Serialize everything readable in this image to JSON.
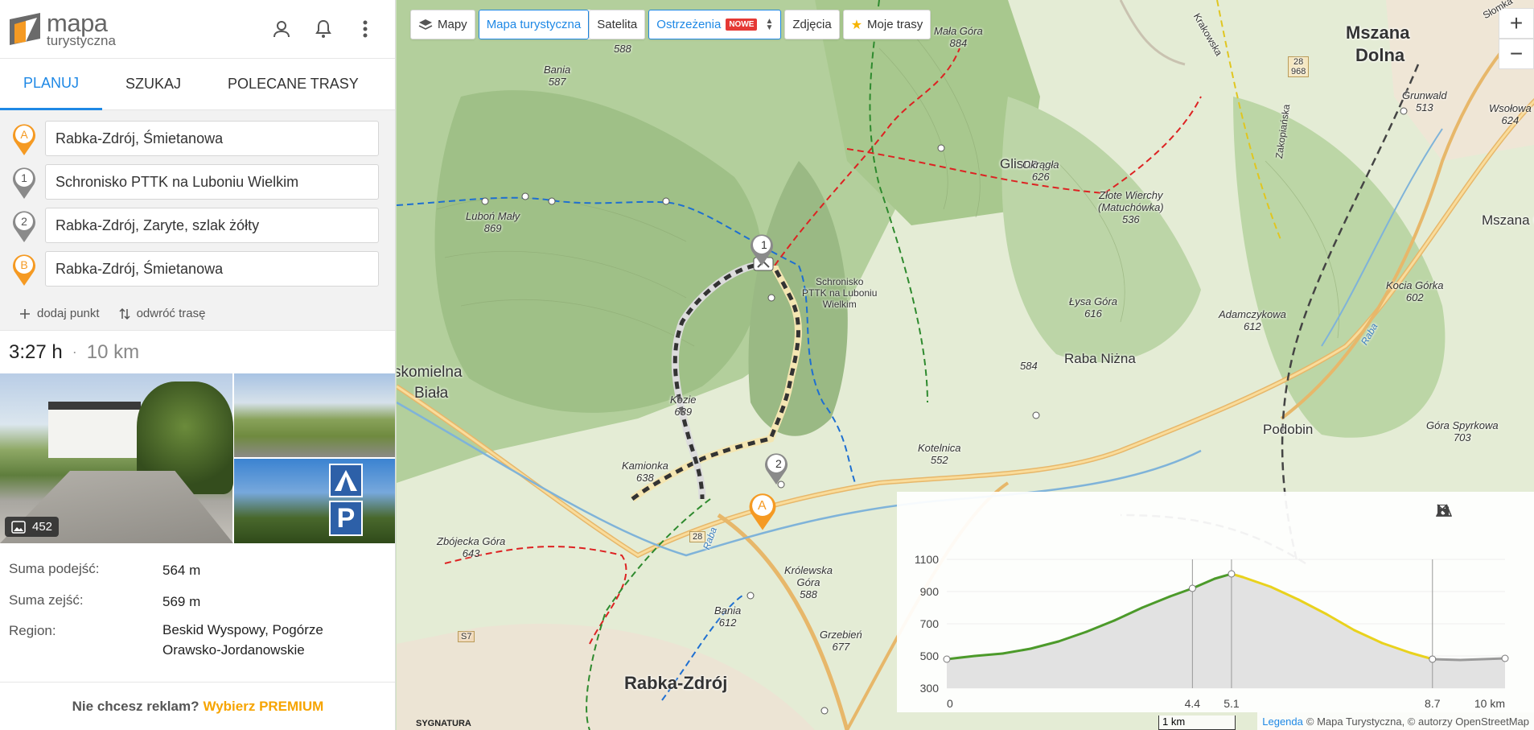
{
  "app": {
    "logo_line1": "mapa",
    "logo_line2": "turystyczna"
  },
  "tabs": [
    {
      "label": "PLANUJ",
      "active": true
    },
    {
      "label": "SZUKAJ",
      "active": false
    },
    {
      "label": "POLECANE TRASY",
      "active": false
    }
  ],
  "route": {
    "points": [
      {
        "marker": "A",
        "value": "Rabka-Zdrój, Śmietanowa",
        "color": "#f59a23"
      },
      {
        "marker": "1",
        "value": "Schronisko PTTK na Luboniu Wielkim",
        "color": "#8a8a8a"
      },
      {
        "marker": "2",
        "value": "Rabka-Zdrój, Zaryte, szlak żółty",
        "color": "#8a8a8a"
      },
      {
        "marker": "B",
        "value": "Rabka-Zdrój, Śmietanowa",
        "color": "#f59a23"
      }
    ],
    "add_point_label": "dodaj punkt",
    "reverse_label": "odwróć trasę"
  },
  "summary": {
    "time": "3:27 h",
    "separator": "·",
    "distance": "10 km"
  },
  "photos": {
    "count": "452"
  },
  "stats": {
    "ascent_label": "Suma podejść:",
    "ascent_value": "564 m",
    "descent_label": "Suma zejść:",
    "descent_value": "569 m",
    "region_label": "Region:",
    "region_value_line1": "Beskid Wyspowy, Pogórze",
    "region_value_line2": "Orawsko-Jordanowskie"
  },
  "ad": {
    "text": "Nie chcesz reklam?",
    "premium": "Wybierz PREMIUM"
  },
  "map_controls": {
    "maps": "Mapy",
    "tourist": "Mapa turystyczna",
    "satellite": "Satelita",
    "warnings": "Ostrzeżenia",
    "new_badge": "NOWE",
    "photos": "Zdjęcia",
    "my_routes": "Moje trasy",
    "zoom_in": "+",
    "zoom_out": "−"
  },
  "map_labels": {
    "mszana": "Mszana",
    "dolna": "Dolna",
    "glisne": "Glisne",
    "raba_nizna": "Raba Niżna",
    "podobin": "Podobin",
    "skomielna": "skomielna",
    "biala": "Biała",
    "rabka": "Rabka-Zdrój",
    "mszana_gorna": "Mszana Górn",
    "mala_gora": "Mała Góra",
    "mala_gora_h": "884",
    "bania1": "Bania",
    "bania1_h": "587",
    "h588top": "588",
    "lubon_maly": "Luboń Mały",
    "lubon_maly_h": "869",
    "okragla": "Okrągła",
    "okragla_h": "626",
    "zlote_wierchy": "Złote Wierchy",
    "matuchowka": "(Matuchówka)",
    "zlote_h": "536",
    "grunwald": "Grunwald",
    "grunwald_h": "513",
    "wsolowa": "Wsołowa",
    "wsolowa_h": "624",
    "kocia_gorka": "Kocia Górka",
    "kocia_h": "602",
    "adamczykowa": "Adamczykowa",
    "adamczykowa_h": "612",
    "lysa_gora": "Łysa Góra",
    "lysa_h": "616",
    "h584": "584",
    "kozie": "Kozie",
    "kozie_h": "639",
    "kamionka": "Kamionka",
    "kamionka_h": "638",
    "kotelnica": "Kotelnica",
    "kotelnica_h": "552",
    "gora_spyrkowa": "Góra Spyrkowa",
    "spyrkowa_h": "703",
    "krolewska": "Królewska",
    "gora": "Góra",
    "krolewska_h": "588",
    "bania2": "Bania",
    "bania2_h": "612",
    "grzebien": "Grzebień",
    "grzebien_h": "677",
    "zbojecka": "Zbójecka Góra",
    "zbojecka_h": "643",
    "schronisko_l1": "Schronisko",
    "schronisko_l2": "PTTK na Luboniu",
    "schronisko_l3": "Wielkim",
    "road28": "28",
    "road28b": "28",
    "road968": "968",
    "roadS7": "S7",
    "zakopianska": "Zakopiańska",
    "krakowska": "Krakowska",
    "slomka": "Słomka",
    "raba_river": "Raba",
    "raba_river2": "Raba",
    "marker_a": "A",
    "marker_1": "1",
    "marker_2": "2"
  },
  "elevation": {
    "y_ticks": [
      "1100",
      "900",
      "700",
      "500",
      "300"
    ],
    "x_ticks": [
      "0",
      "4.4",
      "5.1",
      "8.7",
      "10 km"
    ],
    "profile": [
      [
        0,
        480
      ],
      [
        0.5,
        500
      ],
      [
        1,
        515
      ],
      [
        1.5,
        545
      ],
      [
        2,
        590
      ],
      [
        2.5,
        650
      ],
      [
        3,
        720
      ],
      [
        3.5,
        800
      ],
      [
        4,
        870
      ],
      [
        4.4,
        920
      ],
      [
        4.8,
        980
      ],
      [
        5.1,
        1010
      ],
      [
        5.3,
        990
      ],
      [
        5.8,
        930
      ],
      [
        6.3,
        850
      ],
      [
        6.8,
        760
      ],
      [
        7.3,
        660
      ],
      [
        7.8,
        580
      ],
      [
        8.3,
        520
      ],
      [
        8.7,
        480
      ],
      [
        9.2,
        475
      ],
      [
        9.6,
        480
      ],
      [
        10,
        485
      ]
    ]
  },
  "attribution": {
    "legend": "Legenda",
    "text": "© Mapa Turystyczna, © autorzy OpenStreetMap"
  },
  "scale": "1 km",
  "sygnatura": "SYGNATURA"
}
